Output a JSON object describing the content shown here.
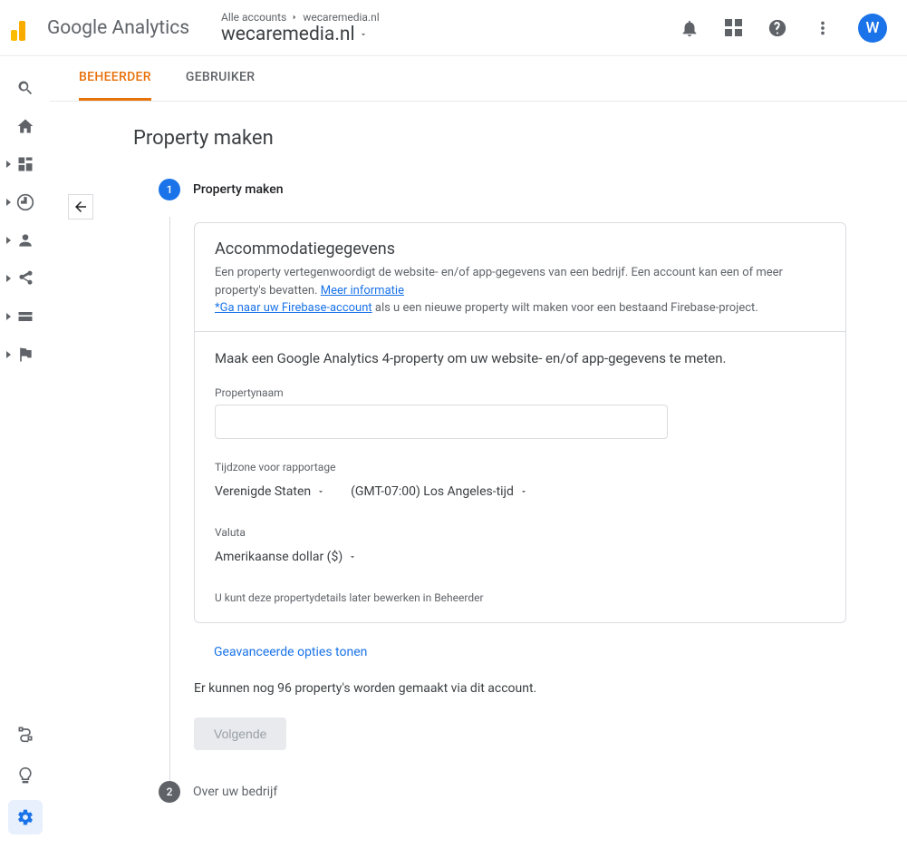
{
  "header": {
    "product": "Google Analytics",
    "breadcrumb_all": "Alle accounts",
    "breadcrumb_site": "wecaremedia.nl",
    "account_name": "wecaremedia.nl",
    "avatar_letter": "W"
  },
  "tabs": {
    "admin": "BEHEERDER",
    "user": "GEBRUIKER"
  },
  "page": {
    "title": "Property maken",
    "step1_label": "Property maken",
    "step2_label": "Over uw bedrijf"
  },
  "card": {
    "heading": "Accommodatiegegevens",
    "description": "Een property vertegenwoordigt de website- en/of app-gegevens van een bedrijf. Een account kan een of meer property's bevatten. ",
    "more_info": "Meer informatie",
    "firebase_link": "*Ga naar uw Firebase-account",
    "firebase_tail": " als u een nieuwe property wilt maken voor een bestaand Firebase-project.",
    "ga4_msg": "Maak een Google Analytics 4-property om uw website- en/of app-gegevens te meten.",
    "property_name_label": "Propertynaam",
    "timezone_label": "Tijdzone voor rapportage",
    "tz_country": "Verenigde Staten",
    "tz_value": "(GMT-07:00) Los Angeles-tijd",
    "currency_label": "Valuta",
    "currency_value": "Amerikaanse dollar ($)",
    "edit_later": "U kunt deze propertydetails later bewerken in Beheerder"
  },
  "advanced_toggle": "Geavanceerde opties tonen",
  "quota_msg": "Er kunnen nog 96 property's worden gemaakt via dit account.",
  "next_btn": "Volgende"
}
